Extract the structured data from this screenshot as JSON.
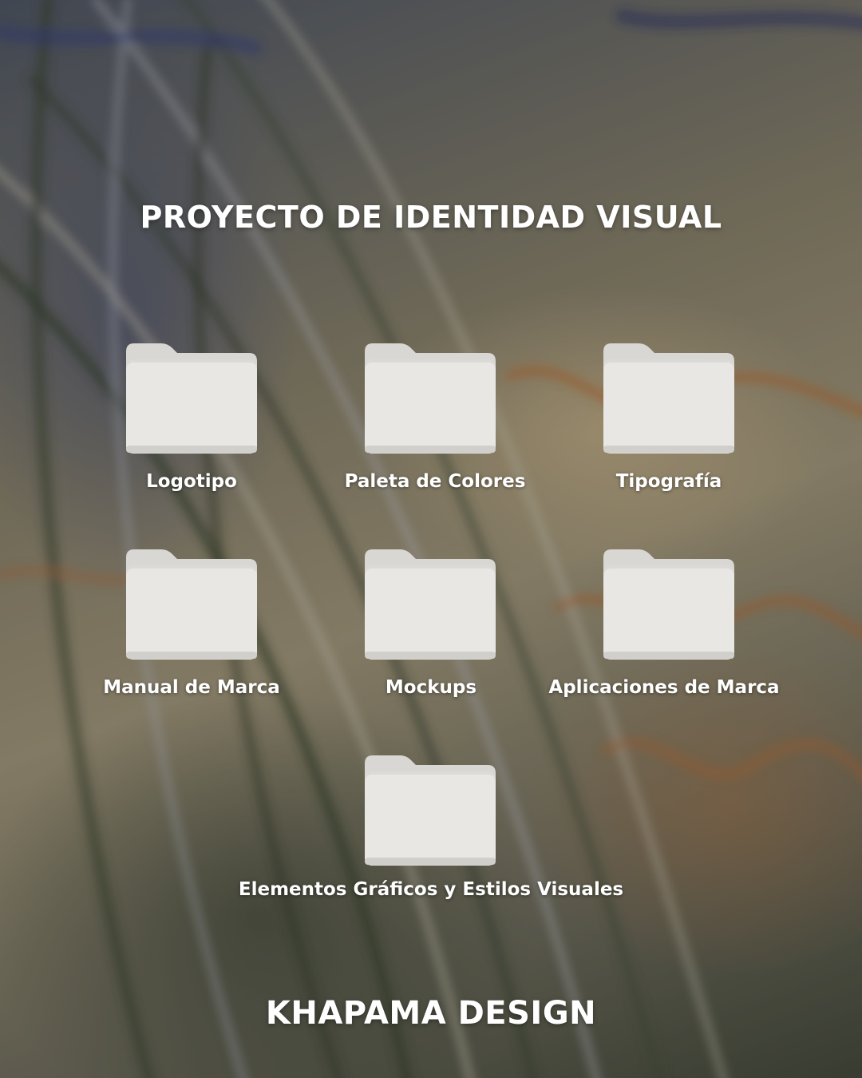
{
  "header": {
    "title": "PROYECTO DE IDENTIDAD VISUAL"
  },
  "folders": [
    {
      "label": "Logotipo",
      "icon": "folder-icon"
    },
    {
      "label": "Paleta de Colores",
      "icon": "folder-icon"
    },
    {
      "label": "Tipografía",
      "icon": "folder-icon"
    },
    {
      "label": "Manual de Marca",
      "icon": "folder-icon"
    },
    {
      "label": "Mockups",
      "icon": "folder-icon"
    },
    {
      "label": "Aplicaciones de Marca",
      "icon": "folder-icon"
    },
    {
      "label": "Elementos Gráficos y Estilos Visuales",
      "icon": "folder-icon"
    }
  ],
  "footer": {
    "brand": "KHAPAMA DESIGN"
  },
  "colors": {
    "folder_front": "#e9e7e3",
    "folder_back": "#d9d7d3",
    "text": "#ffffff"
  }
}
